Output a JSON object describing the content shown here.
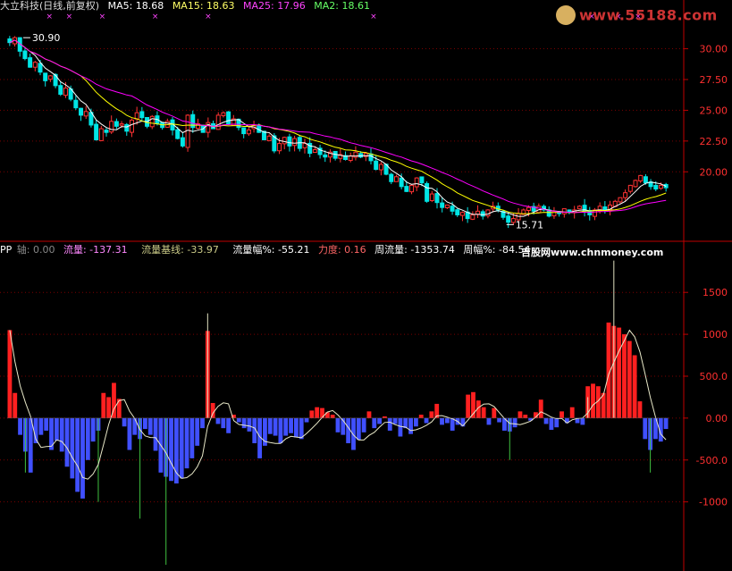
{
  "header_top": {
    "name": "大立科技(日线,前复权)",
    "ma5": "MA5: 18.68",
    "ma15": "MA15: 18.63",
    "ma25": "MA25: 17.96",
    "ma2": "MA2: 18.61"
  },
  "header_bottom": {
    "pp": "PP",
    "axis": "轴: 0.00",
    "flow": "流量: -137.31",
    "flow_base": "流量基线: -33.97",
    "flow_pct": "流量幅%: -55.21",
    "force": "力度: 0.16",
    "week_flow": "周流量: -1353.74",
    "week_pct": "周幅%: -84.54",
    "site": "吉股网www.chnmoney.com"
  },
  "logo": {
    "text": "www.55188.com"
  },
  "colors": {
    "up": "#ff3333",
    "down": "#00e5e5",
    "ma5": "#ffffff",
    "ma15": "#ffff00",
    "ma25": "#ff00ff",
    "axis": "#c00000",
    "pos_bar": "#ff2020",
    "neg_bar": "#4050ff",
    "thin_line": "#b0e0a0",
    "tick_label": "#ff3030"
  },
  "chart_data": [
    {
      "type": "candlestick",
      "title": "大立科技(日线,前复权)",
      "ylim": [
        14.5,
        32.8
      ],
      "yticks": [
        "30.00",
        "27.50",
        "25.00",
        "22.50",
        "20.00"
      ],
      "annotations": [
        {
          "label": "30.90",
          "index": 3,
          "value": 30.9
        },
        {
          "label": "15.71",
          "index": 98,
          "value": 15.71
        }
      ],
      "close": [
        30.5,
        30.9,
        29.8,
        29.2,
        28.5,
        28.9,
        28.1,
        27.4,
        27.8,
        27.0,
        26.3,
        26.8,
        25.9,
        25.2,
        24.6,
        24.9,
        23.8,
        22.6,
        23.5,
        23.2,
        24.1,
        23.7,
        23.9,
        23.3,
        24.2,
        24.8,
        24.4,
        23.7,
        24.5,
        23.9,
        23.6,
        24.1,
        23.4,
        22.7,
        22.1,
        24.6,
        23.6,
        23.9,
        23.2,
        24.0,
        23.5,
        24.6,
        24.8,
        23.9,
        24.3,
        23.6,
        23.1,
        23.4,
        23.8,
        23.2,
        22.6,
        22.9,
        21.7,
        22.3,
        22.8,
        22.1,
        22.7,
        21.9,
        22.3,
        21.5,
        21.8,
        21.4,
        21.2,
        21.6,
        21.1,
        21.4,
        21.0,
        21.3,
        21.6,
        21.2,
        21.5,
        20.9,
        20.2,
        20.6,
        19.8,
        19.2,
        19.6,
        18.8,
        18.4,
        18.9,
        19.5,
        19.1,
        17.6,
        18.2,
        17.5,
        17.1,
        17.3,
        16.8,
        16.5,
        16.7,
        16.2,
        16.5,
        16.8,
        16.4,
        16.9,
        17.2,
        16.9,
        16.3,
        15.9,
        16.2,
        16.6,
        16.9,
        17.1,
        16.8,
        17.2,
        16.9,
        16.4,
        16.8,
        16.6,
        17.0,
        16.7,
        16.9,
        17.2,
        16.8,
        16.5,
        16.9,
        17.2,
        16.9,
        17.3,
        17.6,
        17.9,
        18.3,
        18.9,
        19.3,
        19.7,
        19.1,
        18.8,
        18.6,
        18.9,
        18.7
      ],
      "ma_lines": [
        {
          "name": "MA5",
          "value": 18.68
        },
        {
          "name": "MA15",
          "value": 18.63
        },
        {
          "name": "MA25",
          "value": 17.96
        },
        {
          "name": "MA2",
          "value": 18.61
        }
      ]
    },
    {
      "type": "bar",
      "ylim": [
        -1750,
        1950
      ],
      "yticks": [
        "1500",
        "1000",
        "500.0",
        "0.00",
        "-500.0",
        "-1000"
      ],
      "values": [
        1050,
        300,
        -200,
        -400,
        -650,
        -300,
        -200,
        -150,
        -380,
        -270,
        -400,
        -580,
        -720,
        -880,
        -960,
        -500,
        -280,
        -150,
        300,
        250,
        420,
        230,
        -100,
        -380,
        -200,
        -250,
        -130,
        -200,
        -390,
        -650,
        -700,
        -750,
        -780,
        -720,
        -600,
        -480,
        -330,
        -120,
        1040,
        180,
        -70,
        -120,
        -180,
        40,
        -50,
        -120,
        -160,
        -300,
        -480,
        -330,
        -190,
        -210,
        -300,
        -210,
        -180,
        -230,
        -250,
        -50,
        90,
        130,
        120,
        70,
        40,
        -170,
        -200,
        -300,
        -380,
        -260,
        -170,
        80,
        -120,
        -70,
        20,
        -150,
        -70,
        -220,
        -120,
        -190,
        -100,
        40,
        -60,
        80,
        170,
        -80,
        -60,
        -150,
        -80,
        -100,
        280,
        310,
        210,
        130,
        -80,
        120,
        -50,
        -150,
        -160,
        -110,
        80,
        40,
        -30,
        70,
        220,
        -70,
        -140,
        -110,
        80,
        -60,
        130,
        -60,
        -80,
        380,
        410,
        380,
        300,
        1140,
        1100,
        1080,
        1000,
        920,
        750,
        200,
        -250,
        -380,
        -250,
        -280,
        -130
      ],
      "spikes": [
        {
          "index": 3,
          "value": -650
        },
        {
          "index": 17,
          "value": -1000
        },
        {
          "index": 25,
          "value": -1200
        },
        {
          "index": 30,
          "value": -1750
        },
        {
          "index": 38,
          "value": 1250
        },
        {
          "index": 96,
          "value": -500
        },
        {
          "index": 111,
          "value": 250
        },
        {
          "index": 116,
          "value": 1880
        },
        {
          "index": 123,
          "value": -650
        }
      ],
      "series": [
        {
          "name": "流量基线",
          "value": -33.97
        }
      ]
    }
  ]
}
